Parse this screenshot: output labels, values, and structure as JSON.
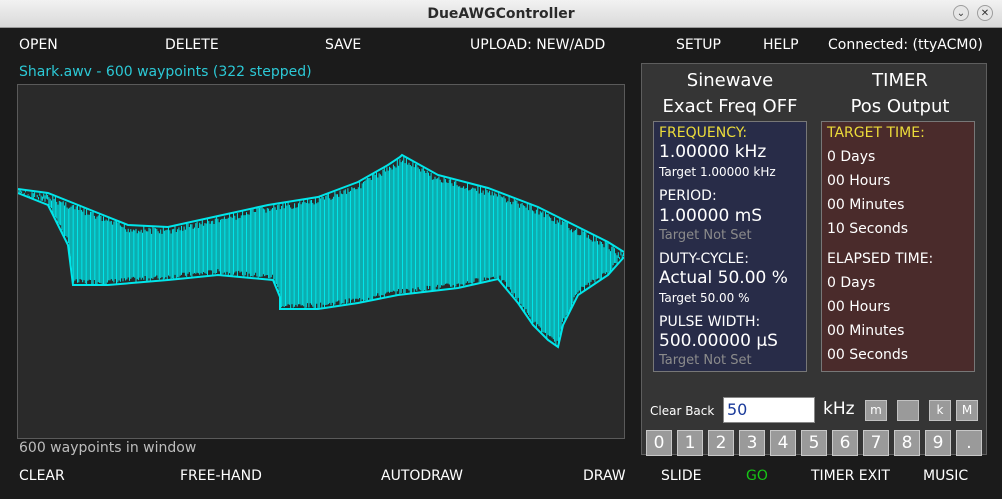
{
  "window": {
    "title": "DueAWGController"
  },
  "menu": {
    "open": "OPEN",
    "delete": "DELETE",
    "save": "SAVE",
    "upload": "UPLOAD: NEW/ADD",
    "setup": "SETUP",
    "help": "HELP",
    "connection": "Connected: (ttyACM0)"
  },
  "waveform": {
    "file_title": "Shark.awv - 600 waypoints (322 stepped)",
    "window_count": "600 waypoints in window",
    "color": "#00e6ea"
  },
  "bottom": {
    "clear": "CLEAR",
    "free_hand": "FREE-HAND",
    "autodraw": "AUTODRAW",
    "draw": "DRAW",
    "slide": "SLIDE",
    "go": "GO",
    "timer_exit": "TIMER EXIT",
    "music": "MUSIC"
  },
  "panel": {
    "wave_name": "Sinewave",
    "exact_freq": "Exact Freq OFF",
    "timer_title": "TIMER",
    "output": "Pos Output",
    "frequency_label": "FREQUENCY:",
    "frequency_value": "1.00000 kHz",
    "frequency_target": "Target  1.00000 kHz",
    "period_label": "PERIOD:",
    "period_value": "1.00000 mS",
    "period_target": "Target Not Set",
    "duty_label": "DUTY-CYCLE:",
    "duty_value": "Actual 50.00 %",
    "duty_target": "Target 50.00 %",
    "pulse_label": "PULSE WIDTH:",
    "pulse_value": "500.00000 µS",
    "pulse_target": "Target Not Set",
    "target_time_label": "TARGET TIME:",
    "target_days": "0 Days",
    "target_hours": "00 Hours",
    "target_minutes": "00 Minutes",
    "target_seconds": "10 Seconds",
    "elapsed_label": "ELAPSED TIME:",
    "elapsed_days": "0 Days",
    "elapsed_hours": "00 Hours",
    "elapsed_minutes": "00 Minutes",
    "elapsed_seconds": "00 Seconds"
  },
  "entry": {
    "clear_back": "Clear Back",
    "value": "50",
    "unit": "kHz",
    "scale_m": "m",
    "scale_none": "",
    "scale_k": "k",
    "scale_M": "M",
    "digits": [
      "0",
      "1",
      "2",
      "3",
      "4",
      "5",
      "6",
      "7",
      "8",
      "9",
      "."
    ]
  }
}
